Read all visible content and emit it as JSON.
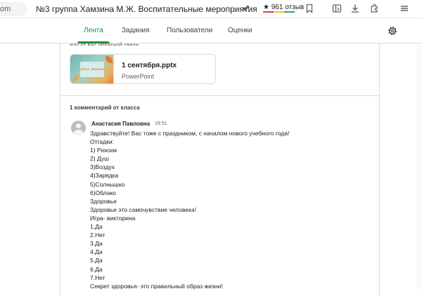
{
  "browser": {
    "address_stub": "om",
    "tab_title": "№3 группа Хамзина М.Ж. Воспитательные мероприятия",
    "rating_text": "★ 961 отзыв",
    "rating_colors": [
      "#e53935",
      "#fbc02d",
      "#43a047"
    ],
    "icons": [
      "pin-icon",
      "bookmark-icon",
      "sidebar-icon",
      "download-icon",
      "extensions-icon",
      "menu-icon"
    ]
  },
  "nav": {
    "tabs": [
      {
        "label": "Лента",
        "active": true
      },
      {
        "label": "Задания",
        "active": false
      },
      {
        "label": "Пользователи",
        "active": false
      },
      {
        "label": "Оценки",
        "active": false
      }
    ],
    "accent_color": "#1e8e3e"
  },
  "post": {
    "cut_text": "иду от вас обратной связи",
    "attachment": {
      "name": "1 сентября.pptx",
      "type": "PowerPoint",
      "thumb_text": "День Знаний"
    },
    "comments_header": "1 комментарий от класса",
    "comment": {
      "author": "Анастасия Павловна",
      "time": "19:51",
      "lines": [
        "Здравствуйте! Вас тоже с праздником, с началом нового учебного года!",
        "Отгадки:",
        "1) Рюкзак",
        "2) Душ",
        "3)Воздух",
        "4)Зарядка",
        "5)Солнышко",
        "6)Облако",
        "Здоровье",
        "Здоровье это самочувствие человека!",
        "Игра- викторина",
        "1.Да",
        "2.Нет",
        "3.Да",
        "4.Да",
        "5.Да",
        "6.Да",
        "7.Нет",
        "Секрет здоровья- это правильный образ жизни!"
      ]
    }
  }
}
